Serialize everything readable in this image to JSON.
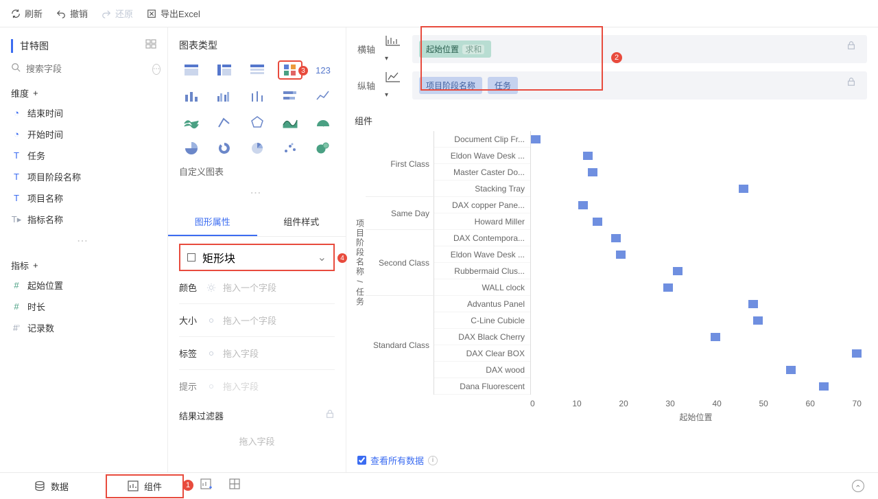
{
  "toolbar": {
    "refresh": "刷新",
    "undo": "撤销",
    "redo": "还原",
    "export": "导出Excel"
  },
  "left": {
    "tab": "甘特图",
    "search_placeholder": "搜索字段",
    "dim_header": "维度",
    "metric_header": "指标",
    "dims": {
      "end_time": "结束时间",
      "start_time": "开始时间",
      "task": "任务",
      "phase_name": "项目阶段名称",
      "project_name": "项目名称",
      "metric_name": "指标名称"
    },
    "metrics": {
      "start_pos": "起始位置",
      "duration": "时长",
      "record_count": "记录数"
    }
  },
  "mid": {
    "chart_type": "图表类型",
    "custom_chart": "自定义图表",
    "num_type": "123",
    "tab_shape": "图形属性",
    "tab_style": "组件样式",
    "shape": "矩形块",
    "props": {
      "color": "颜色",
      "color_ph": "拖入一个字段",
      "size": "大小",
      "size_ph": "拖入一个字段",
      "label": "标签",
      "label_ph": "拖入字段",
      "tip": "提示",
      "tip_ph": "拖入字段"
    },
    "result_filter": "结果过滤器",
    "add_field": "拖入字段"
  },
  "axes": {
    "h": "横轴",
    "v": "纵轴",
    "h_pill1": "起始位置",
    "h_pill2": "求和",
    "v_pill1": "项目阶段名称",
    "v_pill2": "任务"
  },
  "chart_title": "组件",
  "y_label": "项目阶段名称 / 任务",
  "x_label": "起始位置",
  "view_all": "查看所有数据",
  "bottom": {
    "data": "数据",
    "component": "组件"
  },
  "badges": {
    "b1": "1",
    "b2": "2",
    "b3": "3",
    "b4": "4"
  },
  "chart_data": {
    "type": "bar",
    "xlabel": "起始位置",
    "ylabel": "项目阶段名称 / 任务",
    "xlim": [
      0,
      70
    ],
    "xticks": [
      0,
      10,
      20,
      30,
      40,
      50,
      60,
      70
    ],
    "groups": [
      {
        "name": "First Class",
        "rows": [
          {
            "label": "Document Clip Fr...",
            "x": 0
          },
          {
            "label": "Eldon Wave Desk ...",
            "x": 11
          },
          {
            "label": "Master Caster Do...",
            "x": 12
          },
          {
            "label": "Stacking Tray",
            "x": 44
          }
        ]
      },
      {
        "name": "Same Day",
        "rows": [
          {
            "label": "DAX copper Pane...",
            "x": 10
          },
          {
            "label": "Howard Miller",
            "x": 13
          }
        ]
      },
      {
        "name": "Second Class",
        "rows": [
          {
            "label": "DAX Contempora...",
            "x": 17
          },
          {
            "label": "Eldon Wave Desk ...",
            "x": 18
          },
          {
            "label": "Rubbermaid Clus...",
            "x": 30
          },
          {
            "label": "WALL clock",
            "x": 28
          }
        ]
      },
      {
        "name": "Standard Class",
        "rows": [
          {
            "label": "Advantus Panel",
            "x": 46
          },
          {
            "label": "C-Line Cubicle",
            "x": 47
          },
          {
            "label": "DAX Black Cherry",
            "x": 38
          },
          {
            "label": "DAX Clear BOX",
            "x": 68
          },
          {
            "label": "DAX wood",
            "x": 54
          },
          {
            "label": "Dana Fluorescent",
            "x": 61
          }
        ]
      }
    ]
  }
}
